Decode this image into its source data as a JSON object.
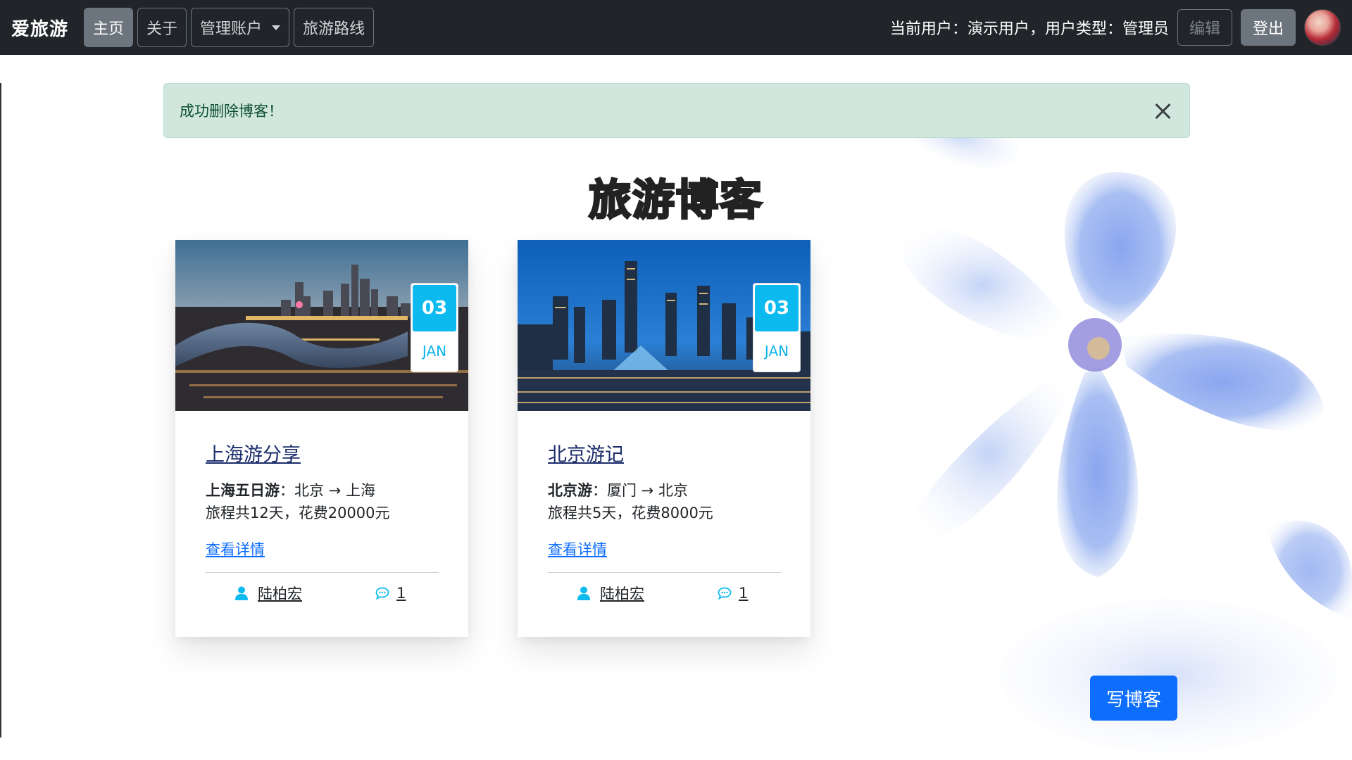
{
  "navbar": {
    "brand": "爱旅游",
    "items": [
      {
        "label": "主页",
        "active": true
      },
      {
        "label": "关于",
        "active": false
      },
      {
        "label": "管理账户",
        "active": false,
        "dropdown": true
      },
      {
        "label": "旅游路线",
        "active": false
      }
    ],
    "user_prefix": "当前用户：",
    "user_name": "演示用户",
    "type_prefix": "，用户类型：",
    "user_type": "管理员",
    "edit_label": "编辑",
    "logout_label": "登出"
  },
  "alert": {
    "message": "成功删除博客！",
    "color": "#d1e7dd"
  },
  "page_title": "旅游博客",
  "cards": [
    {
      "day": "03",
      "month": "JAN",
      "title": "上海游分享",
      "route_name": "上海五日游",
      "route_sep": "：",
      "route": "北京 → 上海",
      "summary": "旅程共12天，花费20000元",
      "detail_link": "查看详情",
      "author": "陆柏宏",
      "comments": "1",
      "image": "shanghai-skyline-photo"
    },
    {
      "day": "03",
      "month": "JAN",
      "title": "北京游记",
      "route_name": "北京游",
      "route_sep": "：",
      "route": "厦门 → 北京",
      "summary": "旅程共5天，花费8000元",
      "detail_link": "查看详情",
      "author": "陆柏宏",
      "comments": "1",
      "image": "beijing-skyline-photo"
    }
  ],
  "write_button": "写博客",
  "colors": {
    "navbar": "#212529",
    "accent": "#0dbaf0",
    "primary": "#0d6efd"
  }
}
